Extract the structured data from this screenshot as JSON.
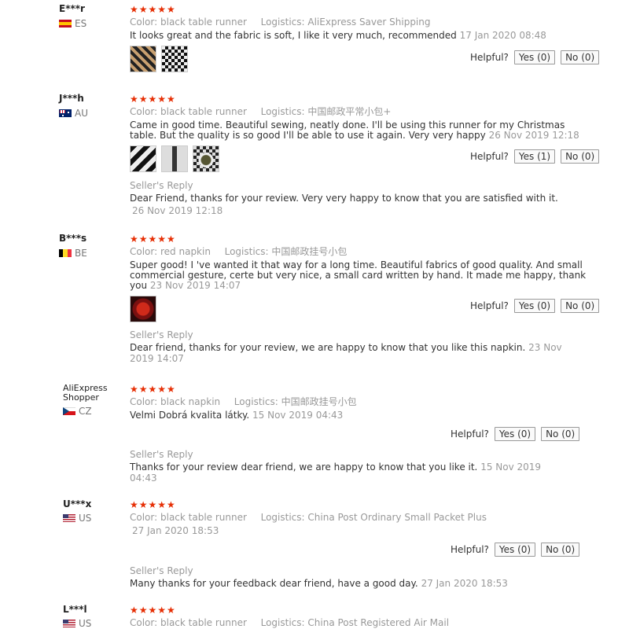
{
  "helpful_label": "Helpful?",
  "color_label": "Color:",
  "logistics_label": "Logistics:",
  "seller_reply_label": "Seller's Reply",
  "stars": "★★★★★",
  "reviews": [
    {
      "user": "E***r",
      "country": "ES",
      "color": "black table runner",
      "logistics": "AliExpress Saver Shipping",
      "text": "It looks great and the fabric is soft, I like it very much, recommended",
      "date": "17 Jan 2020 08:48",
      "yes": "Yes (0)",
      "no": "No (0)"
    },
    {
      "user": "J***h",
      "country": "AU",
      "color": "black table runner",
      "logistics": "中国邮政平常小包+",
      "text_line1": "Came in good time. Beautiful sewing, neatly done. I'll be using this runner for my Christmas",
      "text_line2": "table. But the quality is so good I'll be able to use it again. Very very happy",
      "date": "26 Nov 2019 12:18",
      "yes": "Yes (1)",
      "no": "No (0)",
      "reply": "Dear Friend, thanks for your review. Very very happy to know that you are satisfied with it.",
      "reply_date": "26 Nov 2019 12:18"
    },
    {
      "user": "B***s",
      "country": "BE",
      "color": "red napkin",
      "logistics": "中国邮政挂号小包",
      "text_line1": "Super good! I 've wanted it that way for a long time. Beautiful fabrics of good quality. And small",
      "text_line2": "commercial gesture, certe but very nice, a small card written by hand. It made me happy, thank",
      "text_line3": "you",
      "date": "23 Nov 2019 14:07",
      "yes": "Yes (0)",
      "no": "No (0)",
      "reply": "Dear friend, thanks for your review, we are happy to know that you like this napkin.",
      "reply_date_part1": "23 Nov",
      "reply_date_part2": "2019 14:07"
    },
    {
      "user_line1": "AliExpress",
      "user_line2": "Shopper",
      "country": "CZ",
      "color": "black napkin",
      "logistics": "中国邮政挂号小包",
      "text": "Velmi Dobrá kvalita látky.",
      "date": "15 Nov 2019 04:43",
      "yes": "Yes (0)",
      "no": "No (0)",
      "reply": "Thanks for your review dear friend, we are happy to know that you like it.",
      "reply_date_part1": "15 Nov 2019",
      "reply_date_part2": "04:43"
    },
    {
      "user": "U***x",
      "country": "US",
      "color": "black table runner",
      "logistics": "China Post Ordinary Small Packet Plus",
      "date": "27 Jan 2020 18:53",
      "yes": "Yes (0)",
      "no": "No (0)",
      "reply": "Many thanks for your feedback dear friend, have a good day.",
      "reply_date": "27 Jan 2020 18:53"
    },
    {
      "user": "L***l",
      "country": "US",
      "color": "black table runner",
      "logistics": "China Post Registered Air Mail"
    }
  ]
}
